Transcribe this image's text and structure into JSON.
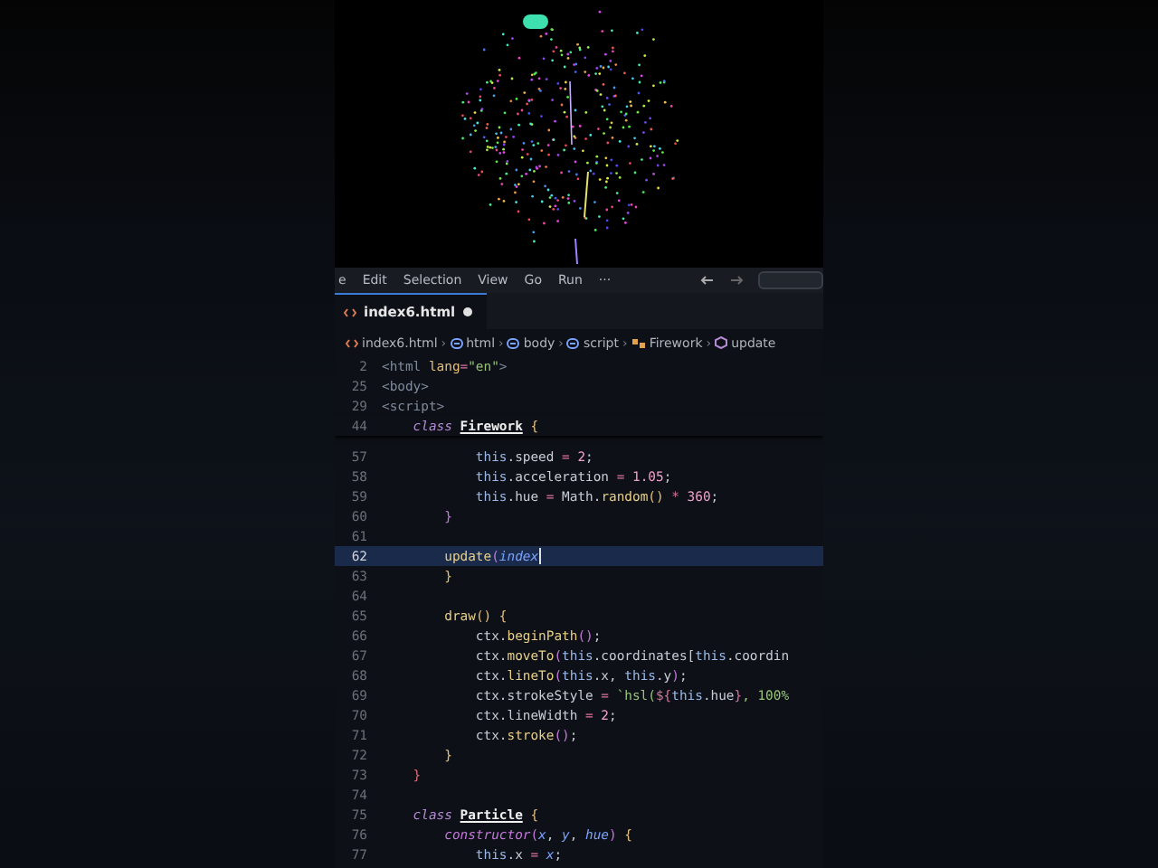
{
  "menu": [
    "e",
    "Edit",
    "Selection",
    "View",
    "Go",
    "Run",
    "···"
  ],
  "tab": {
    "label": "index6.html",
    "modified": true
  },
  "breadcrumb": [
    {
      "kind": "file",
      "label": "index6.html"
    },
    {
      "kind": "tag",
      "separator": "›",
      "label": "html"
    },
    {
      "kind": "tag",
      "separator": "›",
      "label": "body"
    },
    {
      "kind": "tag",
      "separator": "›",
      "label": "script"
    },
    {
      "kind": "class",
      "separator": "›",
      "label": "Firework"
    },
    {
      "kind": "method",
      "separator": "›",
      "label": "update"
    }
  ],
  "sticky": [
    {
      "number": "2",
      "tokens": [
        {
          "kind": "tag",
          "text": "<html "
        },
        {
          "kind": "attr",
          "text": "lang"
        },
        {
          "kind": "op",
          "text": "="
        },
        {
          "kind": "str",
          "text": "\"en\""
        },
        {
          "kind": "tag",
          "text": ">"
        }
      ]
    },
    {
      "number": "25",
      "tokens": [
        {
          "kind": "tag",
          "text": "<body>"
        }
      ]
    },
    {
      "number": "29",
      "tokens": [
        {
          "kind": "tag",
          "text": "<script>"
        }
      ]
    },
    {
      "number": "44",
      "tokens": [
        {
          "kind": "kw",
          "text": "    class "
        },
        {
          "kind": "cls",
          "text": "Firework"
        },
        {
          "kind": "brace",
          "text": " {"
        }
      ]
    }
  ],
  "lines": [
    {
      "number": "57",
      "current": false,
      "tokens": [
        {
          "kind": "this",
          "text": "            this"
        },
        {
          "kind": "plain",
          "text": ".speed "
        },
        {
          "kind": "op",
          "text": "= "
        },
        {
          "kind": "num",
          "text": "2"
        },
        {
          "kind": "plain",
          "text": ";"
        }
      ]
    },
    {
      "number": "58",
      "current": false,
      "tokens": [
        {
          "kind": "this",
          "text": "            this"
        },
        {
          "kind": "plain",
          "text": ".acceleration "
        },
        {
          "kind": "op",
          "text": "= "
        },
        {
          "kind": "num",
          "text": "1.05"
        },
        {
          "kind": "plain",
          "text": ";"
        }
      ]
    },
    {
      "number": "59",
      "current": false,
      "tokens": [
        {
          "kind": "this",
          "text": "            this"
        },
        {
          "kind": "plain",
          "text": ".hue "
        },
        {
          "kind": "op",
          "text": "= "
        },
        {
          "kind": "plain",
          "text": "Math."
        },
        {
          "kind": "fn",
          "text": "random"
        },
        {
          "kind": "brace",
          "text": "() "
        },
        {
          "kind": "op",
          "text": "* "
        },
        {
          "kind": "num",
          "text": "360"
        },
        {
          "kind": "plain",
          "text": ";"
        }
      ]
    },
    {
      "number": "60",
      "current": false,
      "tokens": [
        {
          "kind": "pbrace",
          "text": "        }"
        }
      ]
    },
    {
      "number": "61",
      "current": false
    },
    {
      "number": "62",
      "current": true,
      "tokens": [
        {
          "kind": "fn",
          "text": "        update"
        },
        {
          "kind": "pbrace",
          "text": "("
        },
        {
          "kind": "param",
          "text": "index"
        }
      ]
    },
    {
      "number": "63",
      "current": false,
      "tokens": [
        {
          "kind": "brace",
          "text": "        }"
        }
      ]
    },
    {
      "number": "64",
      "current": false
    },
    {
      "number": "65",
      "current": false,
      "tokens": [
        {
          "kind": "fn",
          "text": "        draw"
        },
        {
          "kind": "brace",
          "text": "() {"
        }
      ]
    },
    {
      "number": "66",
      "current": false,
      "tokens": [
        {
          "kind": "plain",
          "text": "            ctx."
        },
        {
          "kind": "fn",
          "text": "beginPath"
        },
        {
          "kind": "pbrace",
          "text": "()"
        },
        {
          "kind": "plain",
          "text": ";"
        }
      ]
    },
    {
      "number": "67",
      "current": false,
      "tokens": [
        {
          "kind": "plain",
          "text": "            ctx."
        },
        {
          "kind": "fn",
          "text": "moveTo"
        },
        {
          "kind": "pbrace",
          "text": "("
        },
        {
          "kind": "this",
          "text": "this"
        },
        {
          "kind": "plain",
          "text": ".coordinates["
        },
        {
          "kind": "this",
          "text": "this"
        },
        {
          "kind": "plain",
          "text": ".coordin"
        }
      ]
    },
    {
      "number": "68",
      "current": false,
      "tokens": [
        {
          "kind": "plain",
          "text": "            ctx."
        },
        {
          "kind": "fn",
          "text": "lineTo"
        },
        {
          "kind": "pbrace",
          "text": "("
        },
        {
          "kind": "this",
          "text": "this"
        },
        {
          "kind": "plain",
          "text": ".x, "
        },
        {
          "kind": "this",
          "text": "this"
        },
        {
          "kind": "plain",
          "text": ".y"
        },
        {
          "kind": "pbrace",
          "text": ")"
        },
        {
          "kind": "plain",
          "text": ";"
        }
      ]
    },
    {
      "number": "69",
      "current": false,
      "tokens": [
        {
          "kind": "plain",
          "text": "            ctx.strokeStyle "
        },
        {
          "kind": "op",
          "text": "= "
        },
        {
          "kind": "str",
          "text": "`hsl("
        },
        {
          "kind": "op",
          "text": "${"
        },
        {
          "kind": "this",
          "text": "this"
        },
        {
          "kind": "plain",
          "text": ".hue"
        },
        {
          "kind": "op",
          "text": "}"
        },
        {
          "kind": "str",
          "text": ", 100%"
        }
      ]
    },
    {
      "number": "70",
      "current": false,
      "tokens": [
        {
          "kind": "plain",
          "text": "            ctx.lineWidth "
        },
        {
          "kind": "op",
          "text": "= "
        },
        {
          "kind": "num",
          "text": "2"
        },
        {
          "kind": "plain",
          "text": ";"
        }
      ]
    },
    {
      "number": "71",
      "current": false,
      "tokens": [
        {
          "kind": "plain",
          "text": "            ctx."
        },
        {
          "kind": "fn",
          "text": "stroke"
        },
        {
          "kind": "pbrace",
          "text": "()"
        },
        {
          "kind": "plain",
          "text": ";"
        }
      ]
    },
    {
      "number": "72",
      "current": false,
      "tokens": [
        {
          "kind": "brace",
          "text": "        }"
        }
      ]
    },
    {
      "number": "73",
      "current": false,
      "tokens": [
        {
          "kind": "rbrace",
          "text": "    }"
        }
      ]
    },
    {
      "number": "74",
      "current": false
    },
    {
      "number": "75",
      "current": false,
      "tokens": [
        {
          "kind": "kw",
          "text": "    class "
        },
        {
          "kind": "cls",
          "text": "Particle"
        },
        {
          "kind": "brace",
          "text": " {"
        }
      ]
    },
    {
      "number": "76",
      "current": false,
      "tokens": [
        {
          "kind": "kwfn",
          "text": "        constructor"
        },
        {
          "kind": "pbrace",
          "text": "("
        },
        {
          "kind": "param",
          "text": "x"
        },
        {
          "kind": "plain",
          "text": ", "
        },
        {
          "kind": "param",
          "text": "y"
        },
        {
          "kind": "plain",
          "text": ", "
        },
        {
          "kind": "param",
          "text": "hue"
        },
        {
          "kind": "pbrace",
          "text": ")"
        },
        {
          "kind": "brace",
          "text": " {"
        }
      ]
    },
    {
      "number": "77",
      "current": false,
      "tokens": [
        {
          "kind": "this",
          "text": "            this"
        },
        {
          "kind": "plain",
          "text": ".x "
        },
        {
          "kind": "op",
          "text": "= "
        },
        {
          "kind": "param",
          "text": "x"
        },
        {
          "kind": "plain",
          "text": ";"
        }
      ]
    }
  ]
}
